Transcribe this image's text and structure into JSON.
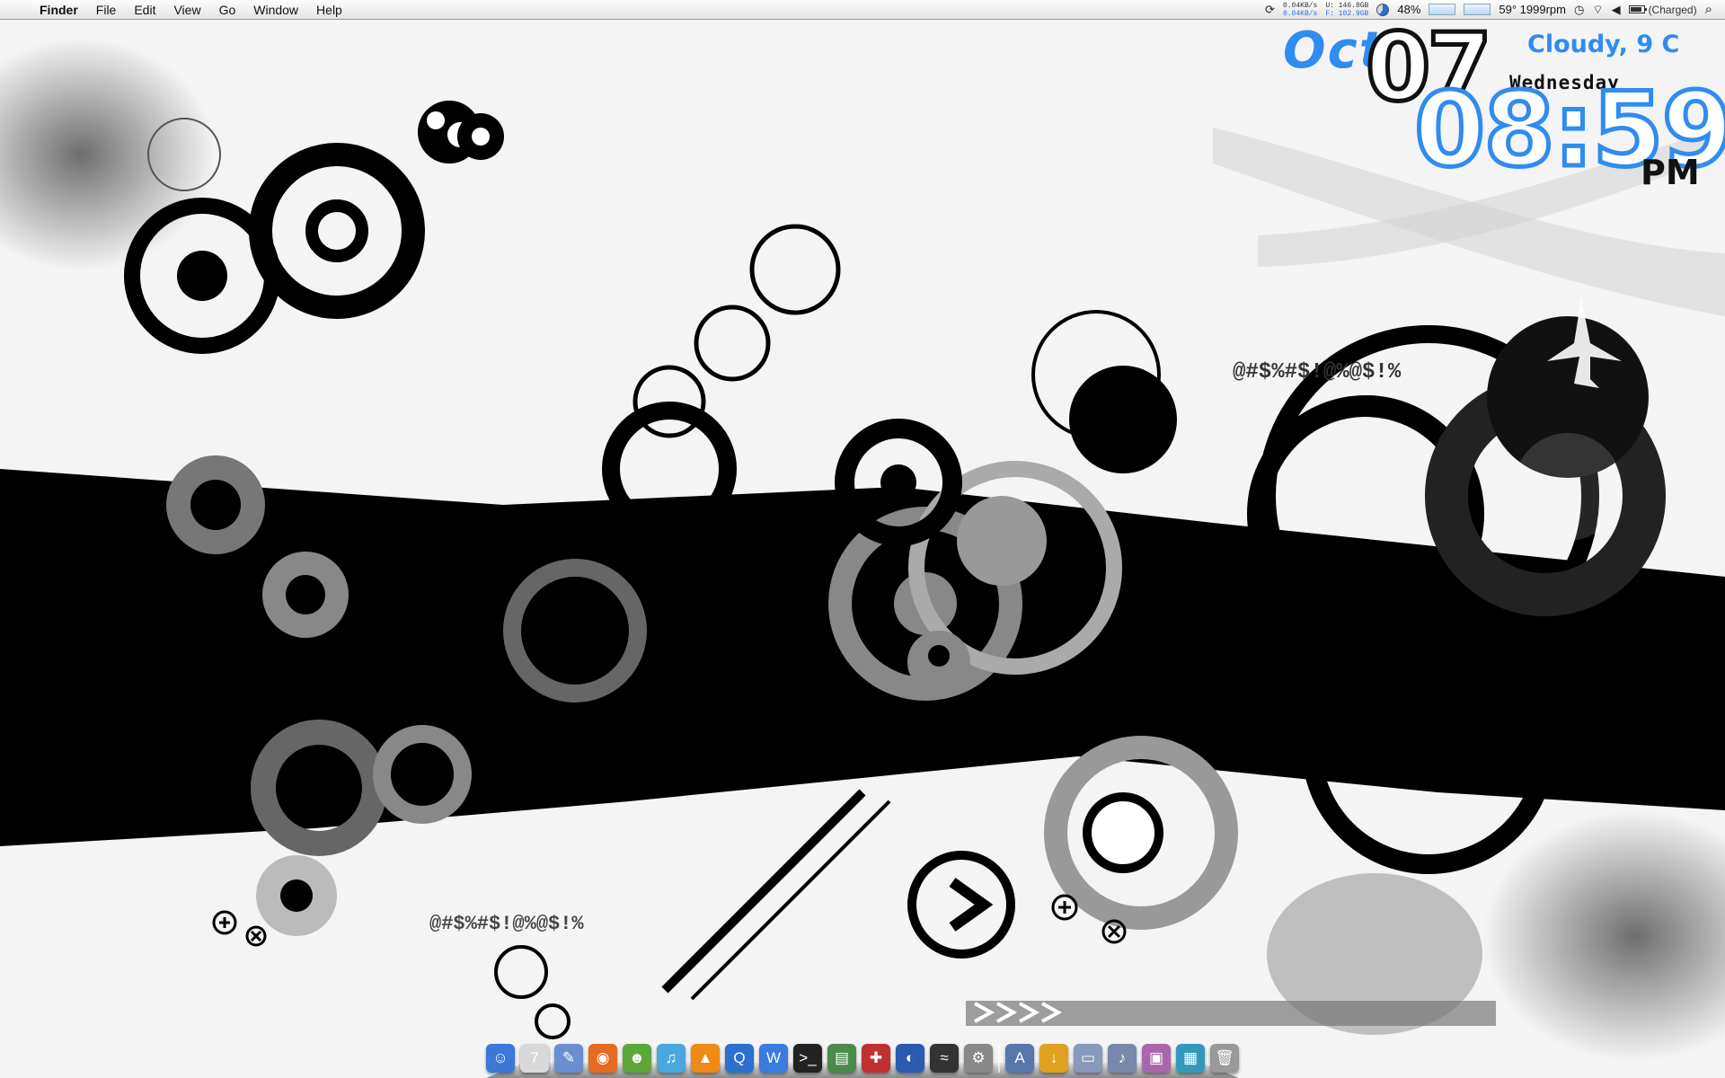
{
  "menubar": {
    "app_name": "Finder",
    "menus": [
      "File",
      "Edit",
      "View",
      "Go",
      "Window",
      "Help"
    ],
    "status": {
      "net_up": "0.04KB/s",
      "net_down": "0.04KB/s",
      "disk_used": "U: 146.8GB",
      "disk_free": "F: 102.9GB",
      "cpu_percent": "48%",
      "temp_fan": "59° 1999rpm",
      "battery": "(Charged)"
    }
  },
  "clock_widget": {
    "month": "Oct",
    "day": "07",
    "weather": "Cloudy, 9 C",
    "weekday": "Wednesday",
    "time": "08:59",
    "ampm": "PM"
  },
  "wallpaper": {
    "overlay_text_1": "@#$%#$!@%@$!%",
    "overlay_text_2": "@#$%#$!@%@$!%"
  },
  "dock": {
    "items": [
      {
        "name": "finder-icon",
        "glyph": "☺",
        "color": "#3b78d8"
      },
      {
        "name": "ical-icon",
        "glyph": "7",
        "color": "#d9d9d9"
      },
      {
        "name": "textedit-icon",
        "glyph": "✎",
        "color": "#6a8fd0"
      },
      {
        "name": "firefox-icon",
        "glyph": "◉",
        "color": "#e66a1f"
      },
      {
        "name": "adium-icon",
        "glyph": "☻",
        "color": "#5da63a"
      },
      {
        "name": "itunes-icon",
        "glyph": "♫",
        "color": "#4aa7e0"
      },
      {
        "name": "vlc-icon",
        "glyph": "▲",
        "color": "#f08a16"
      },
      {
        "name": "quicktime-icon",
        "glyph": "Q",
        "color": "#2b6fd0"
      },
      {
        "name": "word-icon",
        "glyph": "W",
        "color": "#3a7be0"
      },
      {
        "name": "terminal-icon",
        "glyph": ">_",
        "color": "#222222"
      },
      {
        "name": "activity-monitor-icon",
        "glyph": "▤",
        "color": "#4a8a4a"
      },
      {
        "name": "utility-icon",
        "glyph": "✚",
        "color": "#c03030"
      },
      {
        "name": "dashboard-icon",
        "glyph": "◐",
        "color": "#2a5bb0"
      },
      {
        "name": "console-icon",
        "glyph": "≈",
        "color": "#333333"
      },
      {
        "name": "system-preferences-icon",
        "glyph": "⚙",
        "color": "#888888"
      },
      {
        "name": "applications-stack-icon",
        "glyph": "A",
        "color": "#5577aa"
      },
      {
        "name": "downloads-stack-icon",
        "glyph": "↓",
        "color": "#e0a020"
      },
      {
        "name": "documents-stack-icon",
        "glyph": "▭",
        "color": "#8899bb"
      },
      {
        "name": "music-stack-icon",
        "glyph": "♪",
        "color": "#7788aa"
      },
      {
        "name": "pictures-stack-icon",
        "glyph": "▣",
        "color": "#aa66aa"
      },
      {
        "name": "desktop-stack-icon",
        "glyph": "▦",
        "color": "#3399bb"
      },
      {
        "name": "trash-icon",
        "glyph": "🗑",
        "color": "#999999"
      }
    ]
  },
  "colors": {
    "accent": "#2f8cf0",
    "ink": "#000000"
  }
}
